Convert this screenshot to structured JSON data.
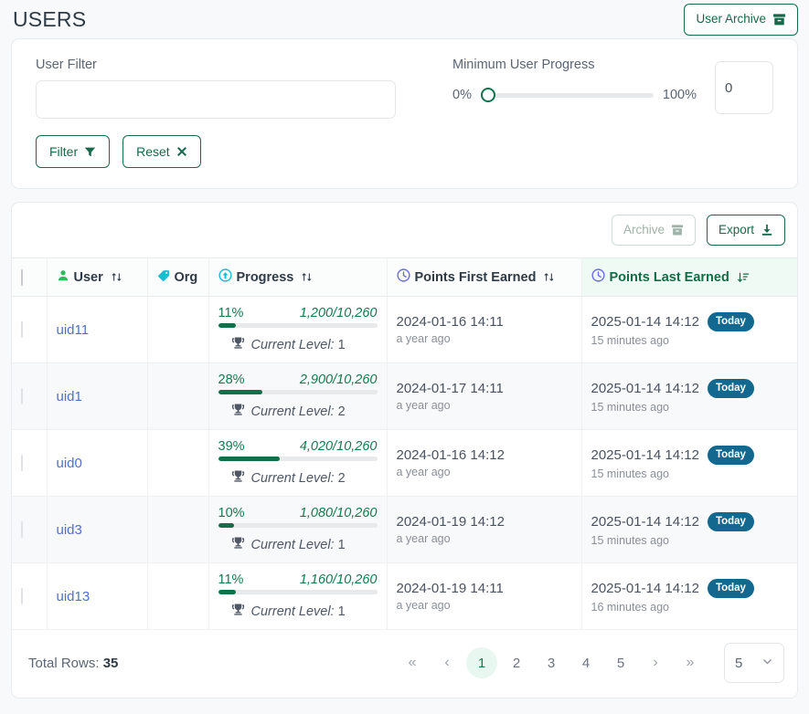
{
  "header": {
    "title": "USERS",
    "archive_button": "User Archive"
  },
  "filters": {
    "user_filter_label": "User Filter",
    "user_filter_value": "",
    "user_filter_placeholder": "",
    "progress_label": "Minimum User Progress",
    "slider_min_label": "0%",
    "slider_max_label": "100%",
    "slider_value": 0,
    "number_value": "0",
    "filter_button": "Filter",
    "reset_button": "Reset"
  },
  "toolbar": {
    "archive_button": "Archive",
    "export_button": "Export"
  },
  "table": {
    "columns": [
      {
        "key": "check",
        "label": "",
        "icon": "",
        "sort": "none"
      },
      {
        "key": "user",
        "label": "User",
        "icon": "person-icon",
        "sort": "both"
      },
      {
        "key": "org",
        "label": "Org",
        "icon": "tag-icon",
        "sort": "none"
      },
      {
        "key": "progress",
        "label": "Progress",
        "icon": "arrow-up-circle-icon",
        "sort": "both"
      },
      {
        "key": "first",
        "label": "Points First Earned",
        "icon": "clock-icon",
        "sort": "both"
      },
      {
        "key": "last",
        "label": "Points Last Earned",
        "icon": "clock-icon",
        "sort": "desc"
      }
    ],
    "level_label": "Current Level:",
    "rows": [
      {
        "user": "uid11",
        "org": "",
        "percent": "11%",
        "percent_value": 11,
        "fraction": "1,200/10,260",
        "level": "1",
        "first_date": "2024-01-16 14:11",
        "first_rel": "a year ago",
        "last_date": "2025-01-14 14:12",
        "last_rel": "15 minutes ago",
        "last_badge": "Today"
      },
      {
        "user": "uid1",
        "org": "",
        "percent": "28%",
        "percent_value": 28,
        "fraction": "2,900/10,260",
        "level": "2",
        "first_date": "2024-01-17 14:11",
        "first_rel": "a year ago",
        "last_date": "2025-01-14 14:12",
        "last_rel": "15 minutes ago",
        "last_badge": "Today"
      },
      {
        "user": "uid0",
        "org": "",
        "percent": "39%",
        "percent_value": 39,
        "fraction": "4,020/10,260",
        "level": "2",
        "first_date": "2024-01-16 14:12",
        "first_rel": "a year ago",
        "last_date": "2025-01-14 14:12",
        "last_rel": "15 minutes ago",
        "last_badge": "Today"
      },
      {
        "user": "uid3",
        "org": "",
        "percent": "10%",
        "percent_value": 10,
        "fraction": "1,080/10,260",
        "level": "1",
        "first_date": "2024-01-19 14:12",
        "first_rel": "a year ago",
        "last_date": "2025-01-14 14:12",
        "last_rel": "15 minutes ago",
        "last_badge": "Today"
      },
      {
        "user": "uid13",
        "org": "",
        "percent": "11%",
        "percent_value": 11,
        "fraction": "1,160/10,260",
        "level": "1",
        "first_date": "2024-01-19 14:11",
        "first_rel": "a year ago",
        "last_date": "2025-01-14 14:12",
        "last_rel": "16 minutes ago",
        "last_badge": "Today"
      }
    ]
  },
  "pagination": {
    "total_label": "Total Rows:",
    "total_value": "35",
    "first_arrow": "«",
    "prev_arrow": "‹",
    "next_arrow": "›",
    "last_arrow": "»",
    "pages": [
      "1",
      "2",
      "3",
      "4",
      "5"
    ],
    "active_page": "1",
    "page_size": "5"
  },
  "colors": {
    "brand_green": "#16694a",
    "progress_green": "#117049",
    "link_blue": "#4f6fd0",
    "badge_blue": "#12688e",
    "icon_cyan": "#17bed0",
    "icon_green": "#2ebd59",
    "icon_purple": "#6b6fe0"
  }
}
